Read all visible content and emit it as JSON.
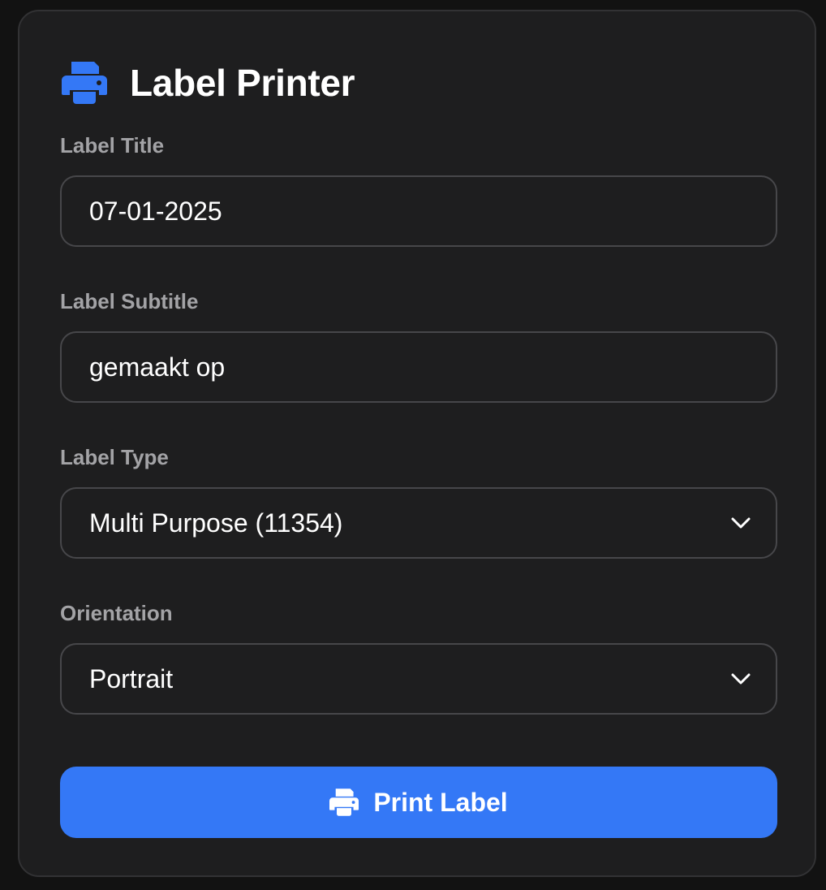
{
  "header": {
    "icon": "printer-icon",
    "title": "Label Printer",
    "accent_color": "#3478f6"
  },
  "fields": {
    "title": {
      "label": "Label Title",
      "value": "07-01-2025"
    },
    "subtitle": {
      "label": "Label Subtitle",
      "value": "gemaakt op"
    },
    "type": {
      "label": "Label Type",
      "value": "Multi Purpose (11354)",
      "icon": "chevron-down-icon"
    },
    "orientation": {
      "label": "Orientation",
      "value": "Portrait",
      "icon": "chevron-down-icon"
    }
  },
  "actions": {
    "print_label": "Print Label",
    "print_icon": "printer-icon",
    "button_color": "#3478f6"
  }
}
